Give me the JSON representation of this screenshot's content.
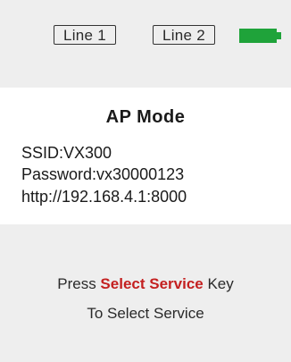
{
  "status_bar": {
    "line1_label": "Line 1",
    "line2_label": "Line 2",
    "battery": {
      "icon": "battery-icon",
      "level": 1.0,
      "color": "#1fa33a"
    }
  },
  "info": {
    "title": "AP Mode",
    "ssid": "SSID:VX300",
    "password": "Password:vx30000123",
    "url": "http://192.168.4.1:8000"
  },
  "instructions": {
    "line1_prefix": "Press ",
    "line1_highlight": "Select Service",
    "line1_suffix": " Key",
    "line2": "To Select Service",
    "highlight_color": "#c42020"
  }
}
